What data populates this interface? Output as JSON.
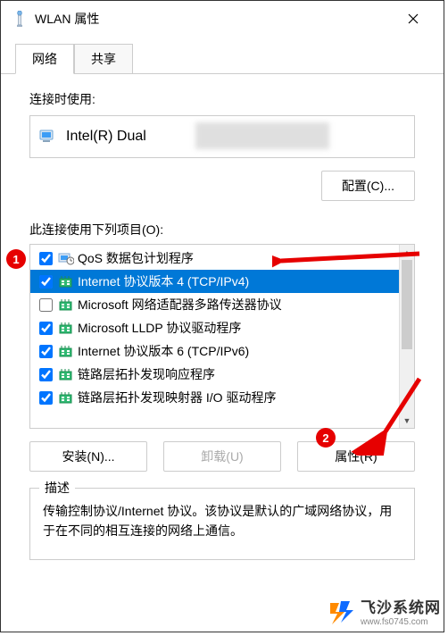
{
  "window": {
    "title": "WLAN 属性"
  },
  "tabs": {
    "network": "网络",
    "share": "共享"
  },
  "connect_using_label": "连接时使用:",
  "adapter_name": "Intel(R) Dual",
  "configure_btn": "配置(C)...",
  "items_label": "此连接使用下列项目(O):",
  "items": [
    {
      "checked": true,
      "label": "QoS 数据包计划程序",
      "selected": false,
      "icon": "scheduler"
    },
    {
      "checked": true,
      "label": "Internet 协议版本 4 (TCP/IPv4)",
      "selected": true,
      "icon": "protocol"
    },
    {
      "checked": false,
      "label": "Microsoft 网络适配器多路传送器协议",
      "selected": false,
      "icon": "protocol"
    },
    {
      "checked": true,
      "label": "Microsoft LLDP 协议驱动程序",
      "selected": false,
      "icon": "protocol"
    },
    {
      "checked": true,
      "label": "Internet 协议版本 6 (TCP/IPv6)",
      "selected": false,
      "icon": "protocol"
    },
    {
      "checked": true,
      "label": "链路层拓扑发现响应程序",
      "selected": false,
      "icon": "protocol"
    },
    {
      "checked": true,
      "label": "链路层拓扑发现映射器 I/O 驱动程序",
      "selected": false,
      "icon": "protocol"
    }
  ],
  "buttons": {
    "install": "安装(N)...",
    "uninstall": "卸载(U)",
    "properties": "属性(R)"
  },
  "description": {
    "legend": "描述",
    "text": "传输控制协议/Internet 协议。该协议是默认的广域网络协议，用于在不同的相互连接的网络上通信。"
  },
  "annotations": {
    "marker1": "1",
    "marker2": "2"
  },
  "watermark": {
    "name": "飞沙系统网",
    "url": "www.fs0745.com"
  }
}
